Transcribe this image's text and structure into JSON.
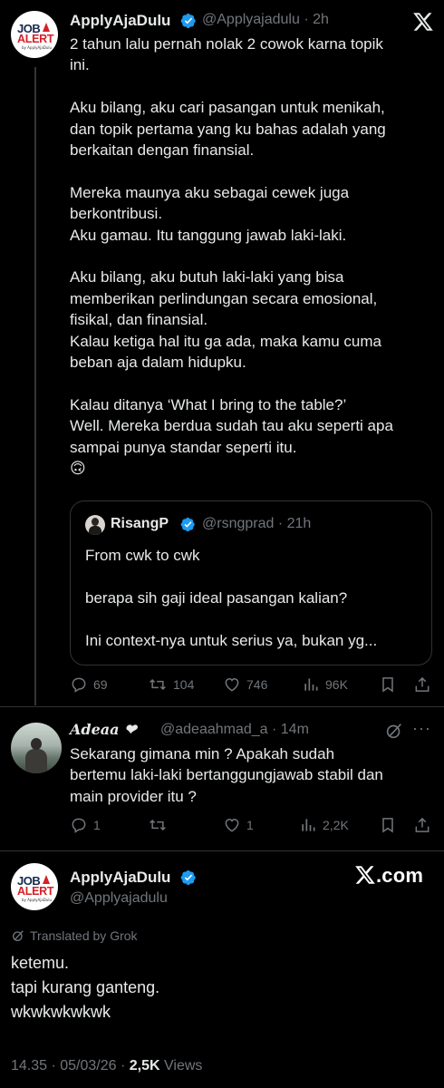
{
  "tweet": {
    "author_name": "ApplyAjaDulu",
    "author_handle": "@Applyajadulu",
    "time": "2h",
    "avatar": {
      "line1": "JOB",
      "line2": "ALERT",
      "line3": "by ApplyAjaDulu"
    },
    "text": "2 tahun lalu pernah nolak 2 cowok karna topik\nini.\n\nAku bilang, aku cari pasangan untuk menikah,\ndan topik pertama yang ku bahas adalah yang\nberkaitan dengan finansial.\n\nMereka maunya aku sebagai cewek juga\nberkontribusi.\nAku gamau. Itu tanggung jawab laki-laki.\n\nAku bilang, aku butuh laki-laki yang bisa\nmemberikan perlindungan secara emosional,\nfisikal, dan finansial.\nKalau ketiga hal itu ga ada, maka kamu cuma\nbeban aja dalam hidupku.\n\nKalau ditanya ‘What I bring to the table?’\nWell. Mereka berdua sudah tau aku seperti apa\nsampai punya standar seperti itu.\n🙃",
    "quote": {
      "author_name": "RisangP",
      "author_handle": "@rsngprad",
      "time": "21h",
      "text": "From cwk to cwk\n\nberapa sih gaji ideal pasangan kalian?\n\nIni context-nya untuk serius ya, bukan yg..."
    },
    "actions": {
      "replies": "69",
      "retweets": "104",
      "likes": "746",
      "views": "96K"
    }
  },
  "reply": {
    "author_name": "𝑨𝒅𝒆𝒂𝒂 ❤",
    "author_handle": "@adeaahmad_a",
    "time": "14m",
    "text": "Sekarang gimana min ? Apakah sudah\nbertemu laki-laki bertanggungjawab stabil dan\nmain provider itu ?",
    "actions": {
      "replies": "1",
      "retweets": "",
      "likes": "1",
      "views": "2,2K"
    }
  },
  "main": {
    "author_name": "ApplyAjaDulu",
    "author_handle": "@Applyajadulu",
    "brand": ".com",
    "translated": "Translated by Grok",
    "text": "ketemu.\ntapi kurang ganteng.\nwkwkwkwkwk",
    "timestamp": "14.35 · 05/03/26 ·",
    "views_count": "2,5K",
    "views_label": "Views"
  },
  "colors": {
    "background": "#000000",
    "text": "#e7e9ea",
    "muted": "#71767b",
    "verified": "#1d9bf0",
    "border": "#2f3336"
  },
  "icons": [
    "x-logo-icon",
    "verified-icon",
    "reply-icon",
    "retweet-icon",
    "like-icon",
    "views-icon",
    "bookmark-icon",
    "share-icon",
    "grok-icon",
    "more-icon",
    "rank-icon"
  ]
}
